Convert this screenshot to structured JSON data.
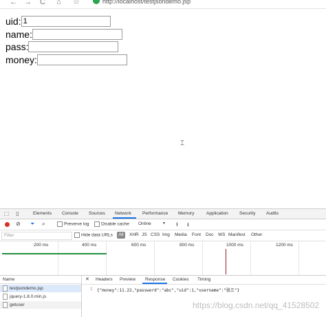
{
  "browser": {
    "back_icon": "←",
    "forward_icon": "→",
    "reload_icon": "C",
    "home_icon": "⌂",
    "star_icon": "☆",
    "url": "http://localhost/testjsondemo.jsp"
  },
  "form": {
    "uid_label": "uid:",
    "uid_value": "1",
    "name_label": "name:",
    "name_value": "",
    "pass_label": "pass:",
    "pass_value": "",
    "money_label": "money:",
    "money_value": ""
  },
  "devtools": {
    "tabs": [
      "Elements",
      "Console",
      "Sources",
      "Network",
      "Performance",
      "Memory",
      "Application",
      "Security",
      "Audits"
    ],
    "active_tab": "Network",
    "toolbar": {
      "preserve_log": "Preserve log",
      "disable_cache": "Disable cache",
      "online": "Online",
      "online_caret": "▼",
      "upload_icon": "⭱",
      "download_icon": "⭳"
    },
    "filter": {
      "placeholder": "Filter",
      "hide_data_urls": "Hide data URLs",
      "all": "All",
      "types": [
        "XHR",
        "JS",
        "CSS",
        "Img",
        "Media",
        "Font",
        "Doc",
        "WS",
        "Manifest",
        "Other"
      ]
    },
    "timeline_ticks": [
      "200 ms",
      "400 ms",
      "600 ms",
      "800 ms",
      "1000 ms",
      "1200 ms"
    ],
    "name_header": "Name",
    "requests": [
      "testjsondemo.jsp",
      "jquery-1.8.0.min.js",
      "getuser"
    ],
    "detail_tabs": [
      "Headers",
      "Preview",
      "Response",
      "Cookies",
      "Timing"
    ],
    "active_detail_tab": "Response",
    "response_line_number": "1",
    "response_body": "{\"money\":11.22,\"password\":\"abc\",\"uid\":1,\"username\":\"张三\"}"
  },
  "watermark": "https://blog.csdn.net/qq_41528502"
}
